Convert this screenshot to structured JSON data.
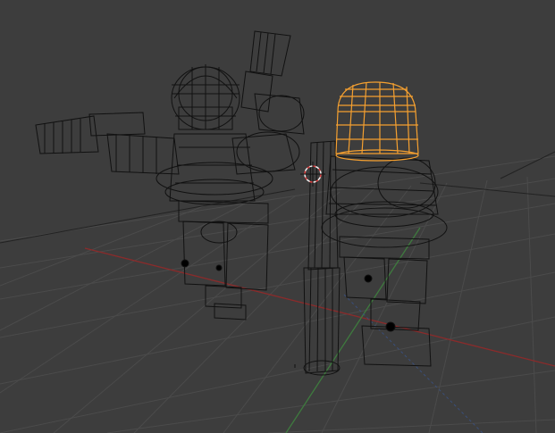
{
  "viewport": {
    "background": "#3d3d3d",
    "grid_color": "#4a4a4a",
    "x_axis_color": "#8a2b2b",
    "y_axis_color": "#3e7a3e",
    "wire_color": "#0a0a0a",
    "selected_color": "#f5a030",
    "cursor_color": "#e04040"
  },
  "scene": {
    "objects": [
      {
        "name": "left-figure",
        "selected": false
      },
      {
        "name": "right-figure-body",
        "selected": false
      },
      {
        "name": "right-figure-helmet",
        "selected": true
      }
    ],
    "cursor_icon": "3d-cursor-icon"
  }
}
